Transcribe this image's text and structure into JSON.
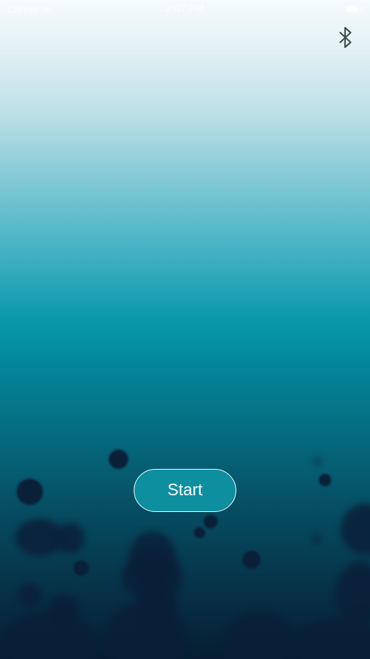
{
  "status_bar": {
    "carrier": "Carrier ᯤ",
    "time": "2:07 PM",
    "battery_icon": "battery-icon",
    "battery_level": 0.8
  },
  "header": {
    "bluetooth_icon": "bluetooth-icon"
  },
  "main": {
    "start_label": "Start"
  },
  "colors": {
    "gradient_top": "#f6fbfc",
    "gradient_mid": "#0a98ab",
    "gradient_bottom": "#061e33",
    "button_fill": "#0d8fa0",
    "silhouette": "#0a1f38"
  }
}
